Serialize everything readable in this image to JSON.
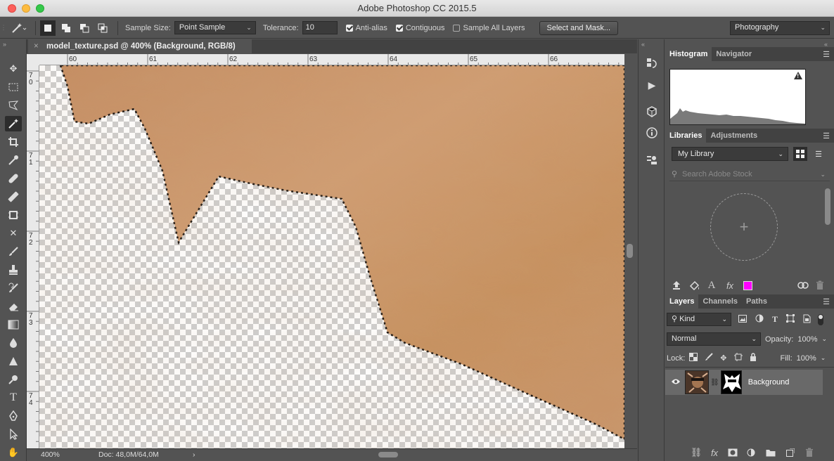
{
  "window": {
    "title": "Adobe Photoshop CC 2015.5"
  },
  "options": {
    "sample_size_label": "Sample Size:",
    "sample_size_value": "Point Sample",
    "tolerance_label": "Tolerance:",
    "tolerance_value": "10",
    "antialias_label": "Anti-alias",
    "antialias_checked": true,
    "contiguous_label": "Contiguous",
    "contiguous_checked": true,
    "sample_all_label": "Sample All Layers",
    "sample_all_checked": false,
    "select_mask_button": "Select and Mask...",
    "workspace_value": "Photography"
  },
  "document": {
    "tab_title": "model_texture.psd @ 400% (Background, RGB/8)",
    "close_icon": "×",
    "ruler_h_labels": [
      "60",
      "61",
      "62",
      "63",
      "64",
      "65",
      "66"
    ],
    "ruler_v_labels": [
      [
        "7",
        "0"
      ],
      [
        "7",
        "1"
      ],
      [
        "7",
        "2"
      ],
      [
        "7",
        "3"
      ],
      [
        "7",
        "4"
      ]
    ],
    "zoom": "400%",
    "doc_size": "Doc: 48,0M/64,0M",
    "status_arrow": "›"
  },
  "panels": {
    "top_tabs": [
      "Histogram",
      "Navigator"
    ],
    "lib_tabs": [
      "Libraries",
      "Adjustments"
    ],
    "library_dd": "My Library",
    "search_placeholder": "Search Adobe Stock",
    "add_glyph": "+",
    "layers_tabs": [
      "Layers",
      "Channels",
      "Paths"
    ],
    "kind_dd": "Kind",
    "blend_mode": "Normal",
    "opacity_label": "Opacity:",
    "opacity_value": "100%",
    "lock_label": "Lock:",
    "fill_label": "Fill:",
    "fill_value": "100%",
    "layer_name": "Background",
    "swatch_color": "#ff00ff"
  },
  "colors": {
    "skin": "#c89468",
    "panel": "#535353",
    "panel_dark": "#424242"
  }
}
